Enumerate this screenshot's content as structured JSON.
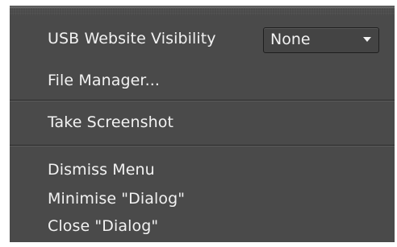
{
  "menu": {
    "usb_visibility": {
      "label": "USB Website Visibility",
      "selected": "None"
    },
    "file_manager": "File Manager...",
    "take_screenshot": "Take Screenshot",
    "dismiss_menu": "Dismiss Menu",
    "minimise_dialog": "Minimise \"Dialog\"",
    "close_dialog": "Close \"Dialog\""
  },
  "colors": {
    "menu_background": "#4a4a4a",
    "text": "#f2f2f2",
    "separator": "#2a2a2a"
  }
}
